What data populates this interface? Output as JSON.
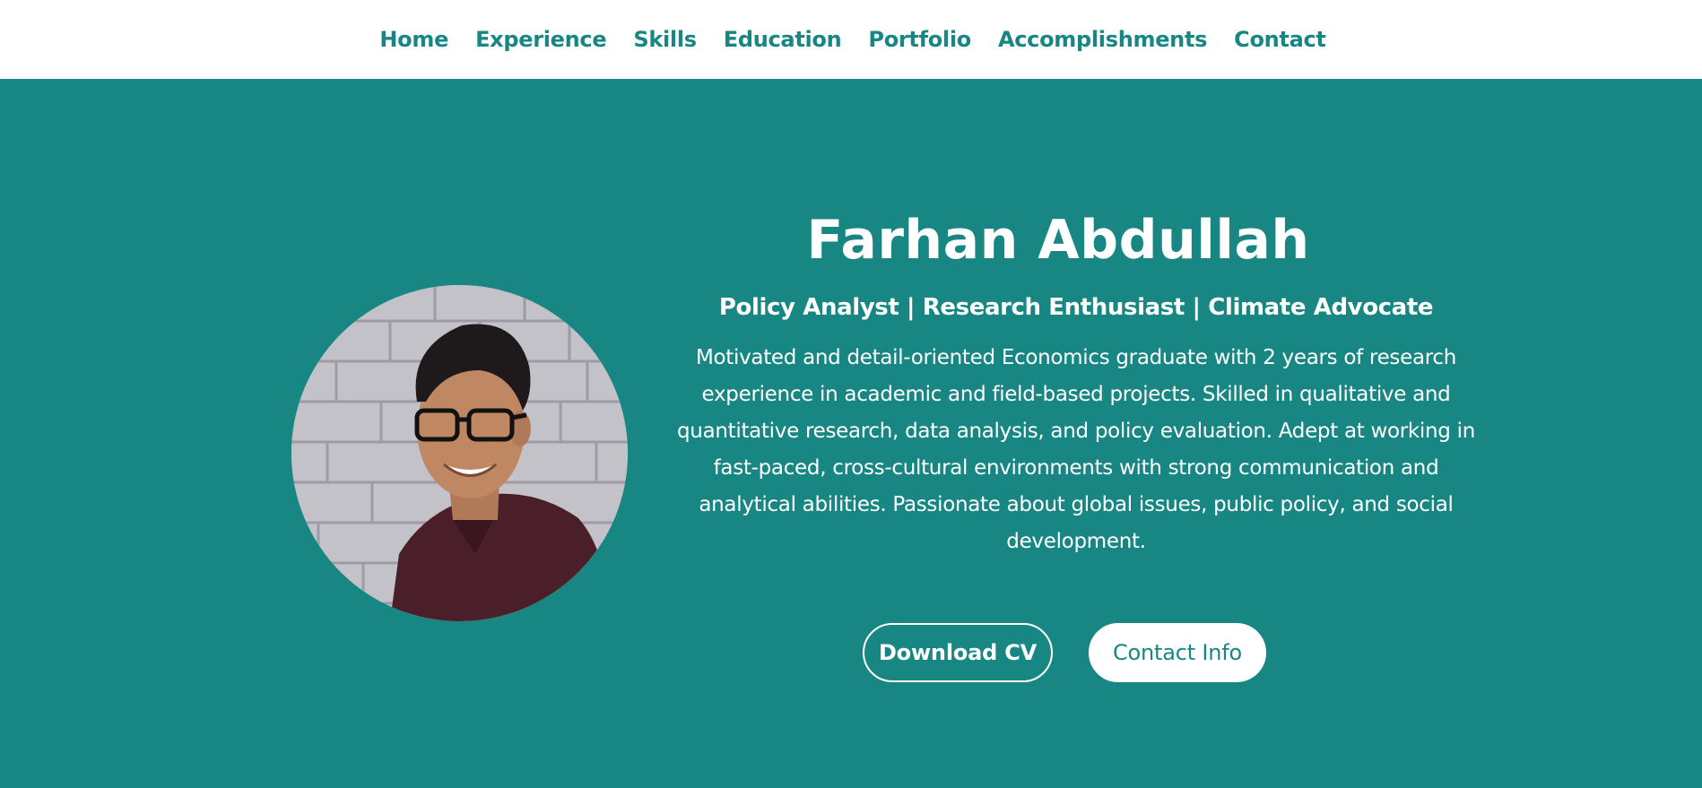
{
  "nav": {
    "links": [
      "Home",
      "Experience",
      "Skills",
      "Education",
      "Portfolio",
      "Accomplishments",
      "Contact"
    ]
  },
  "hero": {
    "name": "Farhan Abdullah",
    "tagline": "Policy Analyst | Research Enthusiast | Climate Advocate",
    "bio": "Motivated and detail-oriented Economics graduate with 2 years of research experience in academic and field-based projects. Skilled in qualitative and quantitative research, data analysis, and policy evaluation. Adept at working in fast-paced, cross-cultural environments with strong communication and analytical abilities. Passionate about global issues, public policy, and social development.",
    "buttons": {
      "download_cv": "Download CV",
      "contact_info": "Contact Info"
    }
  },
  "colors": {
    "accent": "#188783",
    "nav_background": "#ffffff",
    "text_on_accent": "#ffffff"
  }
}
